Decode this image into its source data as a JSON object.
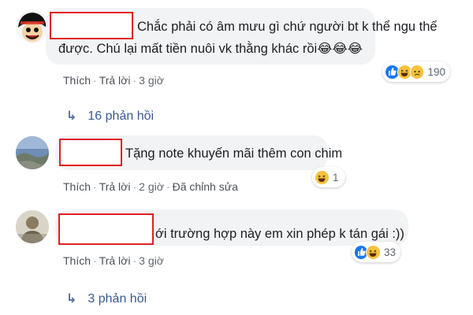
{
  "comments": [
    {
      "text_line1": "Chắc phải có âm mưu gì chứ người bt k thể ngu thế",
      "text_line2": "được. Chú lại mất tiền nuôi vk thằng khác rồi😂😂😂",
      "actions": {
        "like": "Thích",
        "reply": "Trả lời",
        "time": "3 giờ"
      },
      "reactions": {
        "icons": [
          "like-icon",
          "haha-icon",
          "sad-icon"
        ],
        "count": "190"
      },
      "replies_label": "16 phản hồi"
    },
    {
      "text_line1": "Tặng note khuyến mãi thêm con chim",
      "actions": {
        "like": "Thích",
        "reply": "Trả lời",
        "time": "2 giờ",
        "edited": "Đã chỉnh sửa"
      },
      "reactions": {
        "icons": [
          "haha-icon"
        ],
        "count": "1"
      }
    },
    {
      "text_line1": "ới trường hợp này em xin phép k tán gái :))",
      "actions": {
        "like": "Thích",
        "reply": "Trả lời",
        "time": "3 giờ"
      },
      "reactions": {
        "icons": [
          "like-icon",
          "haha-icon"
        ],
        "count": "33"
      },
      "replies_label": "3 phản hồi"
    }
  ],
  "colors": {
    "bubble": "#f2f3f5",
    "redaction_border": "#e02020",
    "link_blue": "#385898",
    "like_blue": "#1877f2",
    "haha_yellow": "#f7c23b"
  }
}
